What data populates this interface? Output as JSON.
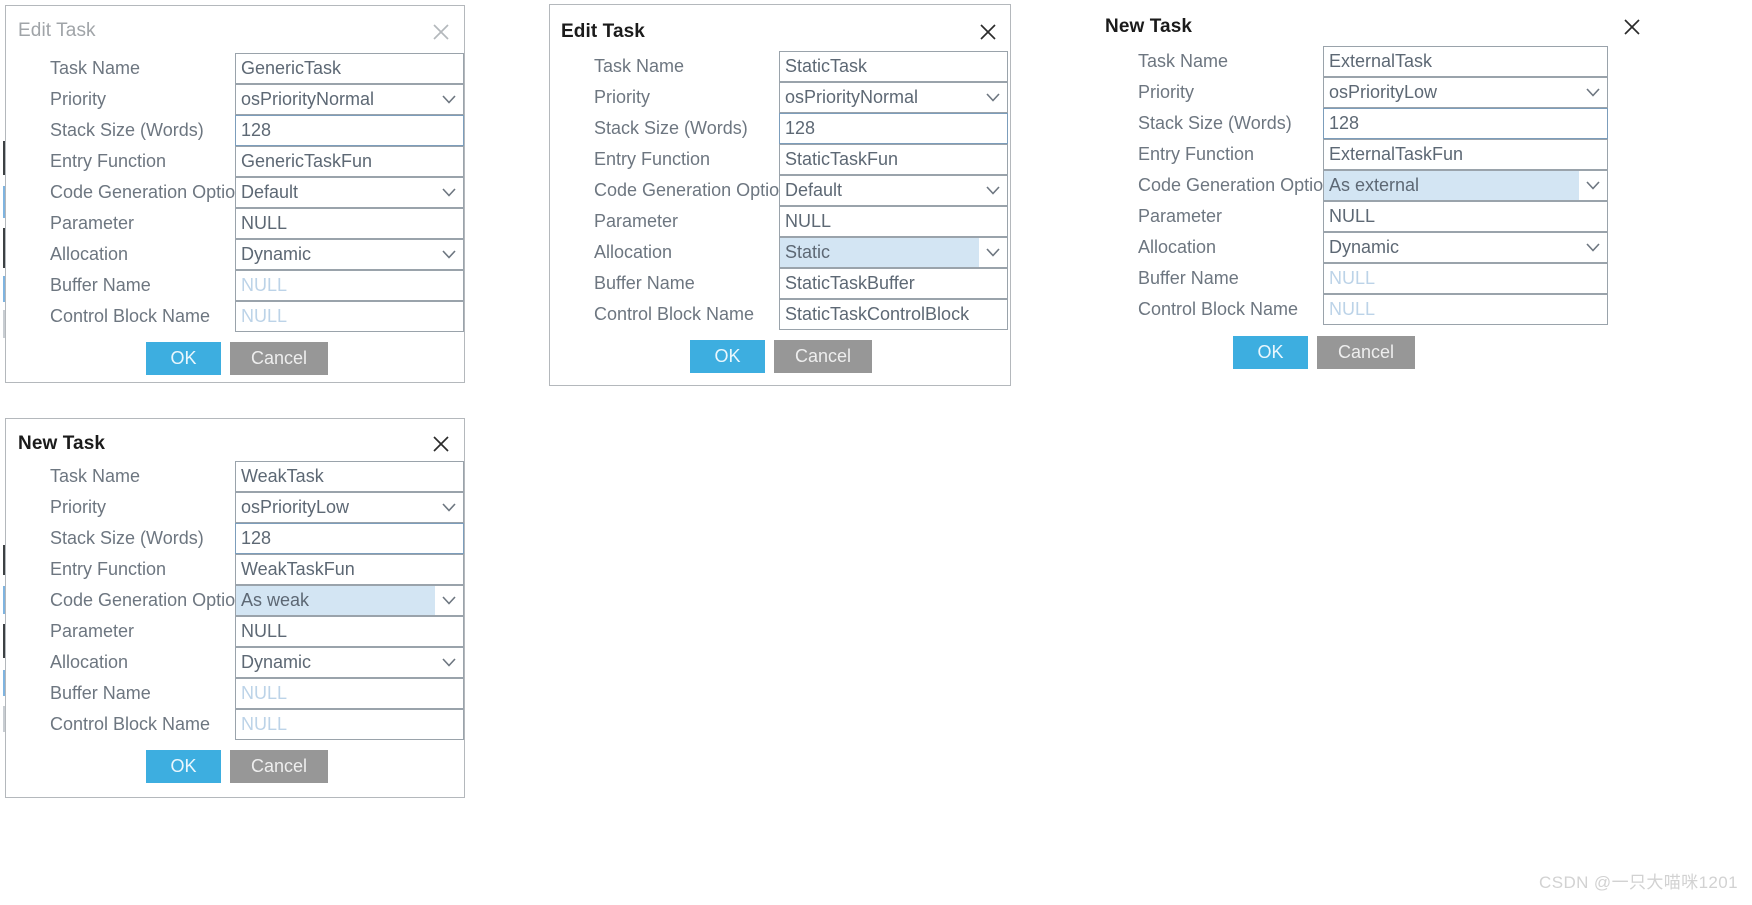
{
  "colors": {
    "accent_ok": "#3daee0",
    "cancel_gray": "#979797",
    "highlight_blue": "#d3e5f3",
    "label_gray": "#6d7680",
    "value_gray": "#5d6874",
    "placeholder_blue": "#bcd3e8",
    "border_gray": "#9aa3ab",
    "title_active": "#1b1b1b",
    "title_inactive": "#a0a4a8"
  },
  "field_labels": {
    "task_name": "Task Name",
    "priority": "Priority",
    "stack_size": "Stack Size (Words)",
    "entry_function": "Entry Function",
    "code_generation_option": "Code Generation Option",
    "parameter": "Parameter",
    "allocation": "Allocation",
    "buffer_name": "Buffer Name",
    "control_block_name": "Control Block Name"
  },
  "buttons": {
    "ok": "OK",
    "cancel": "Cancel"
  },
  "icons": {
    "close": "close-icon",
    "chevron_down": "chevron-down-icon"
  },
  "dialogs": [
    {
      "id": "generic",
      "title": "Edit Task",
      "title_state": "inactive",
      "fields": {
        "task_name": "GenericTask",
        "priority": "osPriorityNormal",
        "stack_size": "128",
        "entry_function": "GenericTaskFun",
        "code_generation_option": "Default",
        "parameter": "NULL",
        "allocation": "Dynamic",
        "buffer_name": "NULL",
        "control_block_name": "NULL"
      }
    },
    {
      "id": "static",
      "title": "Edit Task",
      "title_state": "active",
      "fields": {
        "task_name": "StaticTask",
        "priority": "osPriorityNormal",
        "stack_size": "128",
        "entry_function": "StaticTaskFun",
        "code_generation_option": "Default",
        "parameter": "NULL",
        "allocation": "Static",
        "buffer_name": "StaticTaskBuffer",
        "control_block_name": "StaticTaskControlBlock"
      }
    },
    {
      "id": "external",
      "title": "New Task",
      "title_state": "active",
      "fields": {
        "task_name": "ExternalTask",
        "priority": "osPriorityLow",
        "stack_size": "128",
        "entry_function": "ExternalTaskFun",
        "code_generation_option": "As external",
        "parameter": "NULL",
        "allocation": "Dynamic",
        "buffer_name": "NULL",
        "control_block_name": "NULL"
      }
    },
    {
      "id": "weak",
      "title": "New Task",
      "title_state": "active",
      "fields": {
        "task_name": "WeakTask",
        "priority": "osPriorityLow",
        "stack_size": "128",
        "entry_function": "WeakTaskFun",
        "code_generation_option": "As weak",
        "parameter": "NULL",
        "allocation": "Dynamic",
        "buffer_name": "NULL",
        "control_block_name": "NULL"
      }
    }
  ],
  "watermark": "CSDN @一只大喵咪1201"
}
